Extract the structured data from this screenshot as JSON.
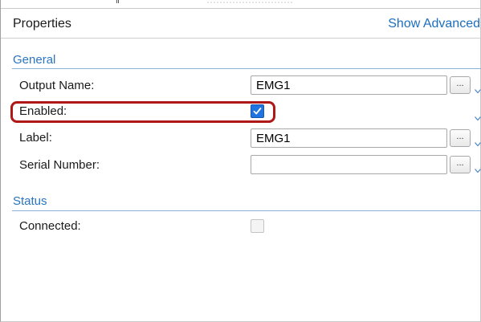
{
  "header": {
    "title": "Properties",
    "show_advanced": "Show Advanced"
  },
  "general": {
    "title": "General",
    "output_name": {
      "label": "Output Name:",
      "value": "EMG1",
      "button": "..."
    },
    "enabled": {
      "label": "Enabled:",
      "checked": true
    },
    "label_field": {
      "label": "Label:",
      "value": "EMG1",
      "button": "..."
    },
    "serial_number": {
      "label": "Serial Number:",
      "value": "",
      "button": "..."
    }
  },
  "status": {
    "title": "Status",
    "connected": {
      "label": "Connected:",
      "checked": false,
      "enabled": false
    }
  },
  "colors": {
    "section_title": "#2a74c0",
    "link": "#1c6ec0",
    "checkbox_checked": "#1f74e0",
    "highlight": "#b01818"
  },
  "icons": [
    "ellipsis-button",
    "chevron-down-icon",
    "checkmark-icon",
    "resize-grip-icon"
  ]
}
